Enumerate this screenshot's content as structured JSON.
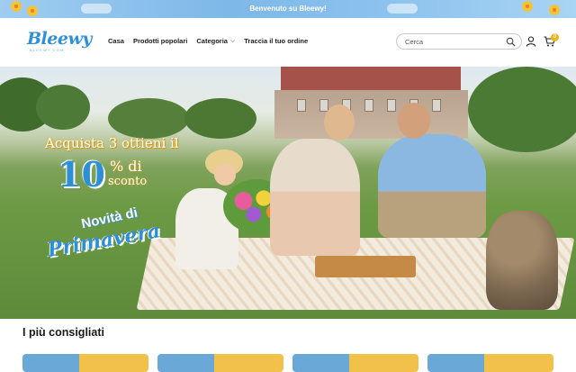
{
  "announcement": {
    "text": "Benvenuto su Bleewy!"
  },
  "header": {
    "logo": {
      "name": "Bleewy",
      "sub": "BLEEWY.COM"
    },
    "nav": [
      {
        "label": "Casa"
      },
      {
        "label": "Prodotti popolari"
      },
      {
        "label": "Categoria",
        "has_dropdown": true
      },
      {
        "label": "Traccia il tuo ordine"
      }
    ],
    "search": {
      "placeholder": "Cerca",
      "icon": "search-icon"
    },
    "account_icon": "user-icon",
    "cart": {
      "icon": "cart-icon",
      "count": "0"
    }
  },
  "hero": {
    "promo_line1": "Acquista 3 ottieni il",
    "promo_number": "10",
    "promo_percent": "% di",
    "promo_discount": "sconto",
    "novita": "Novità di",
    "primavera": "Primavera"
  },
  "recommended": {
    "title": "I più consigliati"
  },
  "colors": {
    "brand_blue": "#2f8fd8",
    "accent_yellow": "#f3b21a",
    "announce_bg": "#7db8e8"
  }
}
